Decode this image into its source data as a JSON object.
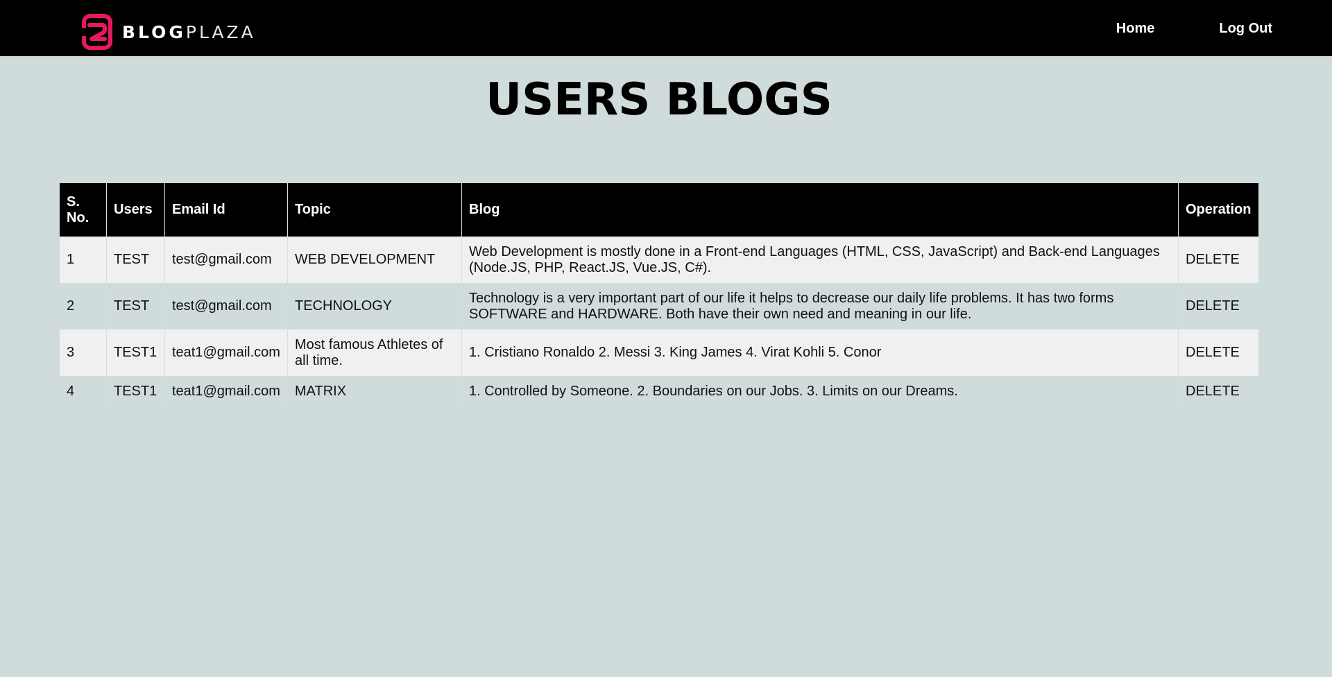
{
  "brand": {
    "name_bold": "BLOG",
    "name_light": "PLAZA",
    "accent_color": "#e8185f"
  },
  "nav": {
    "home": "Home",
    "logout": "Log Out"
  },
  "page": {
    "title": "USERS BLOGS"
  },
  "table": {
    "headers": {
      "sno": "S. No.",
      "users": "Users",
      "email": "Email Id",
      "topic": "Topic",
      "blog": "Blog",
      "operation": "Operation"
    },
    "rows": [
      {
        "sno": "1",
        "user": "TEST",
        "email": "test@gmail.com",
        "topic": "WEB DEVELOPMENT",
        "blog": "Web Development is mostly done in a Front-end Languages (HTML, CSS, JavaScript) and Back-end Languages (Node.JS, PHP, React.JS, Vue.JS, C#).",
        "operation": "DELETE"
      },
      {
        "sno": "2",
        "user": "TEST",
        "email": "test@gmail.com",
        "topic": "TECHNOLOGY",
        "blog": "Technology is a very important part of our life it helps to decrease our daily life problems. It has two forms SOFTWARE and HARDWARE. Both have their own need and meaning in our life.",
        "operation": "DELETE"
      },
      {
        "sno": "3",
        "user": "TEST1",
        "email": "teat1@gmail.com",
        "topic": "Most famous Athletes of all time.",
        "blog": "1. Cristiano Ronaldo 2. Messi 3. King James 4. Virat Kohli 5. Conor",
        "operation": "DELETE"
      },
      {
        "sno": "4",
        "user": "TEST1",
        "email": "teat1@gmail.com",
        "topic": "MATRIX",
        "blog": "1. Controlled by Someone. 2. Boundaries on our Jobs. 3. Limits on our Dreams.",
        "operation": "DELETE"
      }
    ]
  }
}
